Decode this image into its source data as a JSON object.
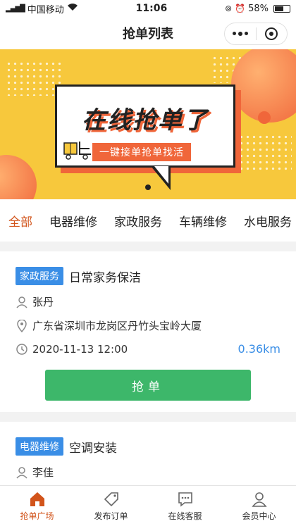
{
  "status_bar": {
    "carrier": "中国移动",
    "time": "11:06",
    "battery": "58%",
    "battery_level": 0.58
  },
  "nav": {
    "title": "抢单列表"
  },
  "banner": {
    "headline": "在线抢单了",
    "subline": "一键接单抢单找活"
  },
  "categories": [
    {
      "label": "全部",
      "active": true
    },
    {
      "label": "电器维修",
      "active": false
    },
    {
      "label": "家政服务",
      "active": false
    },
    {
      "label": "车辆维修",
      "active": false
    },
    {
      "label": "水电服务",
      "active": false
    }
  ],
  "orders": [
    {
      "badge": "家政服务",
      "title": "日常家务保洁",
      "person": "张丹",
      "address": "广东省深圳市龙岗区丹竹头宝岭大厦",
      "time": "2020-11-13 12:00",
      "distance": "0.36km",
      "button": "抢单"
    },
    {
      "badge": "电器维修",
      "title": "空调安装",
      "person": "李佳"
    }
  ],
  "tabbar": [
    {
      "label": "抢单广场",
      "icon": "home-icon",
      "active": true
    },
    {
      "label": "发布订单",
      "icon": "tag-icon",
      "active": false
    },
    {
      "label": "在线客服",
      "icon": "chat-icon",
      "active": false
    },
    {
      "label": "会员中心",
      "icon": "user-icon",
      "active": false
    }
  ],
  "colors": {
    "accent": "#d2541b",
    "badge": "#3a8ee6",
    "grab_button": "#3db76a",
    "banner_bg": "#f7c83c"
  }
}
